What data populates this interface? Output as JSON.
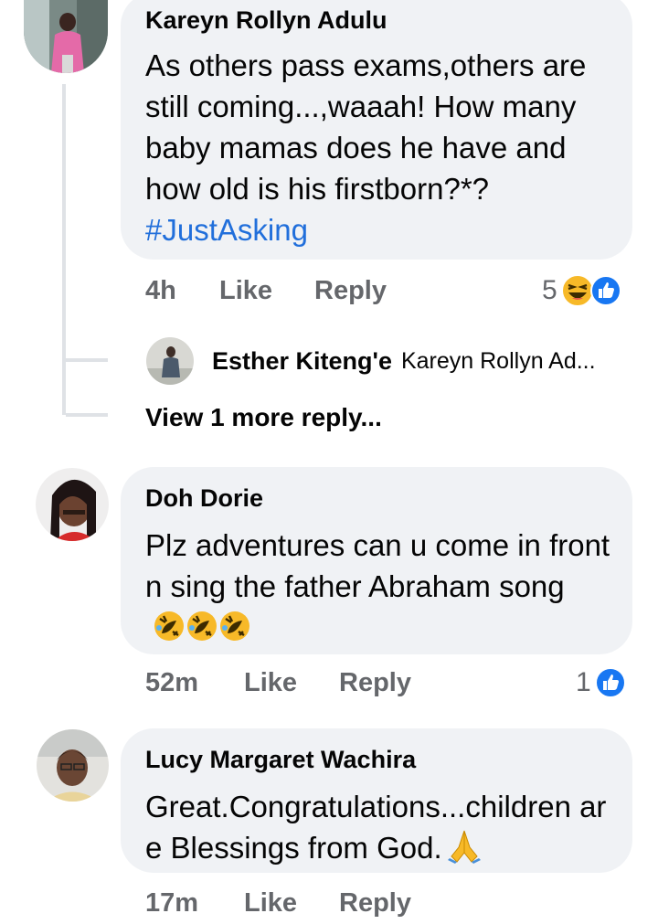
{
  "comments": [
    {
      "author": "Kareyn Rollyn Adulu",
      "text": "As others pass exams,others are still coming...,waaah! How many baby mamas does he have and how old is his firstborn?*?",
      "hashtag": "#JustAsking",
      "time": "4h",
      "like_label": "Like",
      "reply_label": "Reply",
      "reaction_count": "5",
      "reactions": [
        "laughing-emoji",
        "like-icon"
      ]
    },
    {
      "author": "Doh Dorie",
      "text": "Plz adventures can u come in front n sing the father Abraham song",
      "emojis": [
        "rolling-laughing-emoji",
        "rolling-laughing-emoji",
        "rolling-laughing-emoji"
      ],
      "time": "52m",
      "like_label": "Like",
      "reply_label": "Reply",
      "reaction_count": "1",
      "reactions": [
        "like-icon"
      ]
    },
    {
      "author": "Lucy Margaret Wachira",
      "text": "Great.Congratulations...children are Blessings from God.",
      "emojis": [
        "praying-hands-emoji"
      ],
      "time": "17m",
      "like_label": "Like",
      "reply_label": "Reply"
    }
  ],
  "nested_reply": {
    "author": "Esther Kiteng'e",
    "preview": "Kareyn Rollyn Ad..."
  },
  "view_more_label": "View 1 more reply...",
  "colors": {
    "bubble": "#f0f2f5",
    "meta_text": "#65676b",
    "hashtag": "#216fdb",
    "like_blue": "#1877f2",
    "emoji_yellow": "#f7b928"
  }
}
